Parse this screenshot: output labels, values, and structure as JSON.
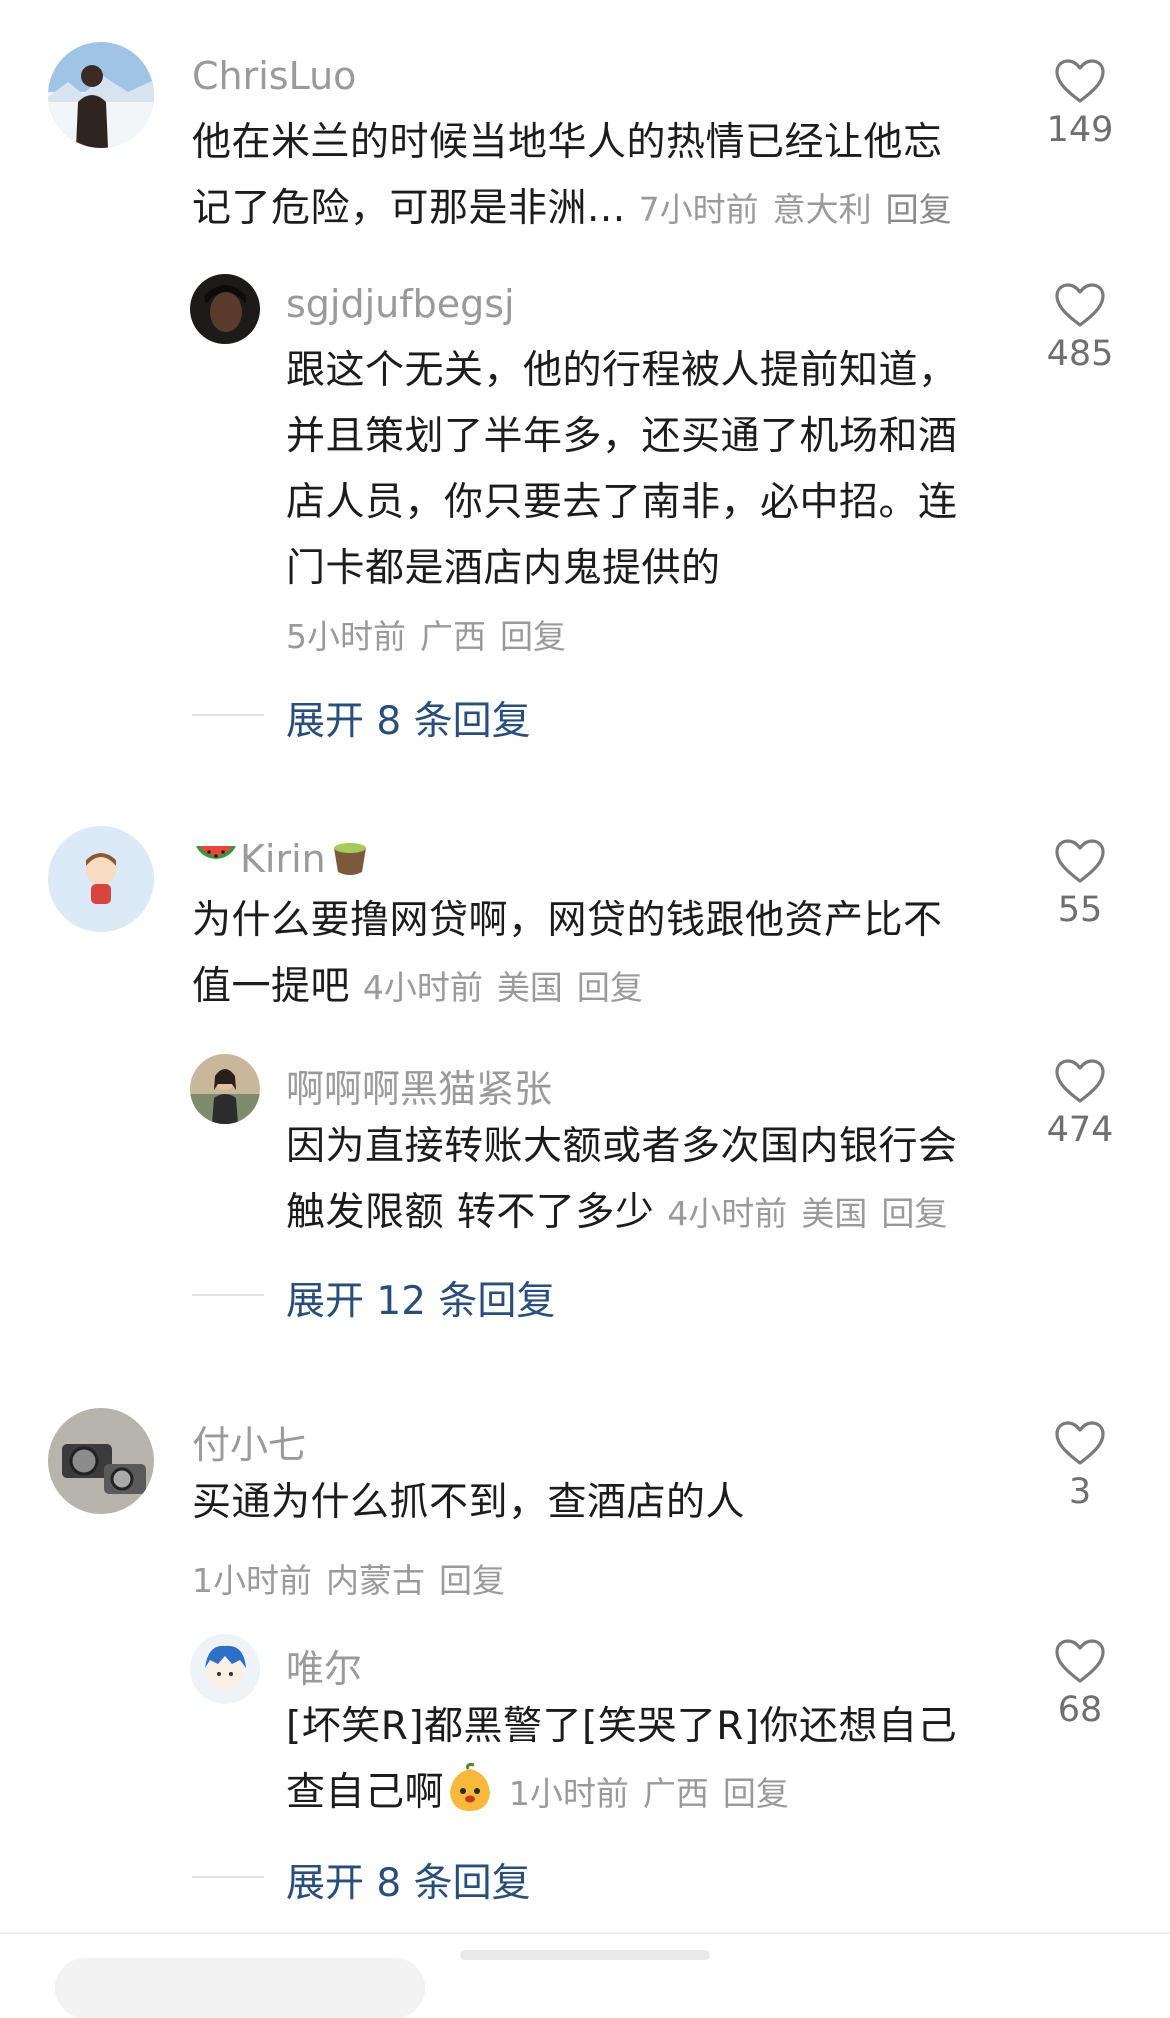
{
  "comments": [
    {
      "user": "ChrisLuo",
      "text": "他在米兰的时候当地华人的热情已经让他忘记了危险，可那是非洲...",
      "line1": "他在米兰的时候当地华人的热情已经让他忘",
      "line2": "记了危险，可那是非洲...",
      "time": "7小时前",
      "location": "意大利",
      "reply_label": "回复",
      "likes": "149",
      "avatar_icon": "person-snow-landscape-avatar",
      "replies": [
        {
          "user": "sgjdjufbegsj",
          "lines": [
            "跟这个无关，他的行程被人提前知道，",
            "并且策划了半年多，还买通了机场和酒",
            "店人员，你只要去了南非，必中招。连",
            "门卡都是酒店内鬼提供的"
          ],
          "time": "5小时前",
          "location": "广西",
          "reply_label": "回复",
          "likes": "485",
          "avatar_icon": "dark-portrait-avatar"
        }
      ],
      "expand_label": "展开 8 条回复"
    },
    {
      "user": "Kirin",
      "user_prefix_icon": "watermelon-emoji",
      "user_suffix_icon": "tea-cup-emoji",
      "line1": "为什么要撸网贷啊，网贷的钱跟他资产比不",
      "line2": "值一提吧",
      "time": "4小时前",
      "location": "美国",
      "reply_label": "回复",
      "likes": "55",
      "avatar_icon": "cartoon-boy-moon-avatar",
      "replies": [
        {
          "user": "啊啊啊黑猫紧张",
          "line1": "因为直接转账大额或者多次国内银行会",
          "line2": "触发限额 转不了多少",
          "time": "4小时前",
          "location": "美国",
          "reply_label": "回复",
          "likes": "474",
          "avatar_icon": "woman-photo-avatar"
        }
      ],
      "expand_label": "展开 12 条回复"
    },
    {
      "user": "付小七",
      "line1": "买通为什么抓不到，查酒店的人",
      "time": "1小时前",
      "location": "内蒙古",
      "reply_label": "回复",
      "likes": "3",
      "avatar_icon": "vintage-camera-avatar",
      "replies": [
        {
          "user": "唯尔",
          "line1": "[坏笑R]都黑警了[笑哭了R]你还想自己",
          "line2": "查自己啊",
          "sticker_icon": "cute-mango-sticker",
          "time": "1小时前",
          "location": "广西",
          "reply_label": "回复",
          "likes": "68",
          "avatar_icon": "cartoon-blue-hair-avatar"
        }
      ],
      "expand_label": "展开 8 条回复"
    }
  ],
  "colors": {
    "username": "#9a9a9a",
    "body_text": "#1c1c1c",
    "meta": "#9a9a9a",
    "expand_link": "#2a4e7a",
    "heart_stroke": "#7a7a7a"
  }
}
